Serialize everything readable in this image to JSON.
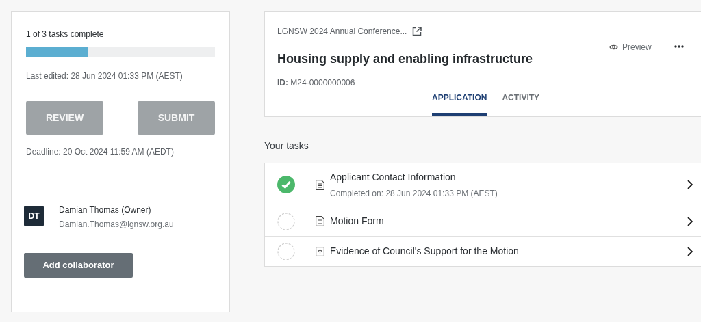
{
  "progress": {
    "label": "1 of 3 tasks complete",
    "level": 0.33
  },
  "last_edited": "Last edited: 28 Jun 2024 01:33 PM (AEST)",
  "buttons": [
    {
      "label": "REVIEW",
      "disabled": true
    },
    {
      "label": "SUBMIT",
      "disabled": true
    }
  ],
  "deadline": "Deadline: 20 Oct 2024 11:59 AM (AEDT)",
  "collaborator": {
    "initials": "DT",
    "name": "Damian Thomas (Owner)",
    "email": "Damian.Thomas@lgnsw.org.au"
  },
  "add_collaborator": "Add collaborator",
  "header": {
    "breadcrumb": "LGNSW 2024 Annual Conference...",
    "title": "Housing supply and enabling infrastructure",
    "id": "**ID:** M24-0000000006",
    "preview": "Preview"
  },
  "tabs": [
    {
      "label": "APPLICATION",
      "selected": true
    },
    {
      "label": "ACTIVITY",
      "selected": false
    }
  ],
  "tasks_heading": "Your tasks",
  "tasks": [
    {
      "kind": "form",
      "title": "Applicant Contact Information",
      "completed": true,
      "completed_on": "Completed on: 28 Jun 2024 01:33 PM (AEST)"
    },
    {
      "kind": "form",
      "title": "Motion Form",
      "completed": false
    },
    {
      "kind": "upload",
      "title": "Evidence of Council's Support for the Motion",
      "completed": false
    }
  ]
}
